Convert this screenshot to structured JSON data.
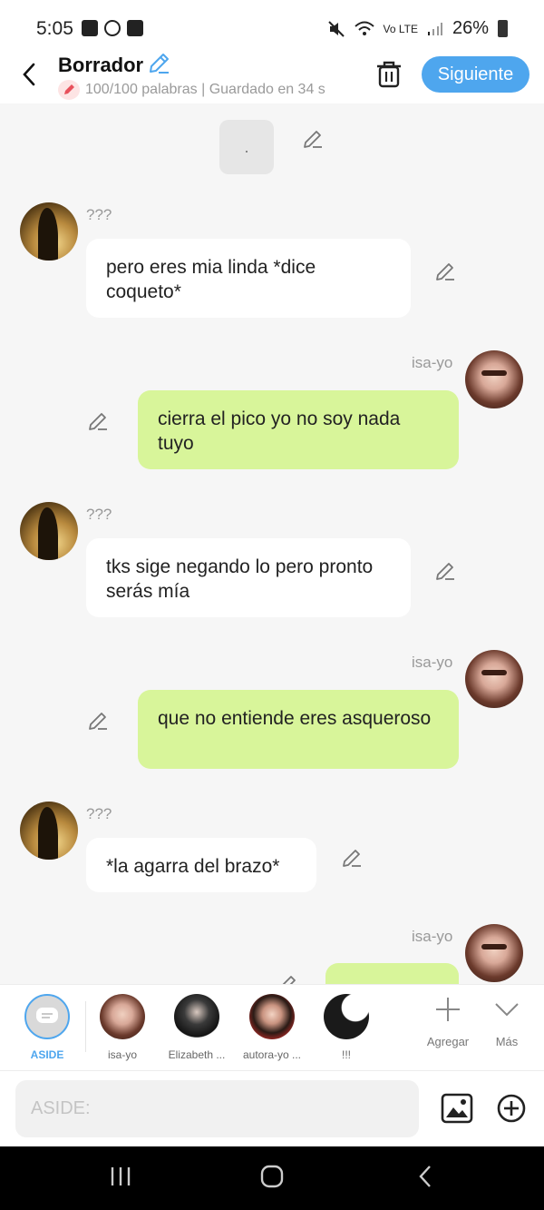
{
  "status_bar": {
    "time": "5:05",
    "network_label": "Vo LTE",
    "battery": "26%"
  },
  "header": {
    "title": "Borrador",
    "subtitle": "100/100 palabras | Guardado en 34 s",
    "next_label": "Siguiente"
  },
  "chat": {
    "system_message": ".",
    "messages": [
      {
        "sender": "???",
        "text": "pero eres mia linda *dice coqueto*",
        "side": "in"
      },
      {
        "sender": "isa-yo",
        "text": "cierra el pico yo no soy nada tuyo",
        "side": "out"
      },
      {
        "sender": "???",
        "text": "tks sige negando lo pero pronto serás mía",
        "side": "in"
      },
      {
        "sender": "isa-yo",
        "text": "que no entiende eres asqueroso",
        "side": "out"
      },
      {
        "sender": "???",
        "text": "*la agarra del brazo*",
        "side": "in"
      },
      {
        "sender": "isa-yo",
        "text": "",
        "side": "out"
      }
    ]
  },
  "characters": [
    {
      "name": "ASIDE",
      "selected": true
    },
    {
      "name": "isa-yo"
    },
    {
      "name": "Elizabeth ..."
    },
    {
      "name": "autora-yo ..."
    },
    {
      "name": "!!!"
    }
  ],
  "actions": {
    "add_label": "Agregar",
    "more_label": "Más"
  },
  "composer": {
    "placeholder": "ASIDE:",
    "value": ""
  },
  "colors": {
    "accent": "#4ea6ee",
    "out_bubble": "#d8f59a",
    "in_bubble": "#ffffff",
    "background": "#f6f6f6"
  }
}
